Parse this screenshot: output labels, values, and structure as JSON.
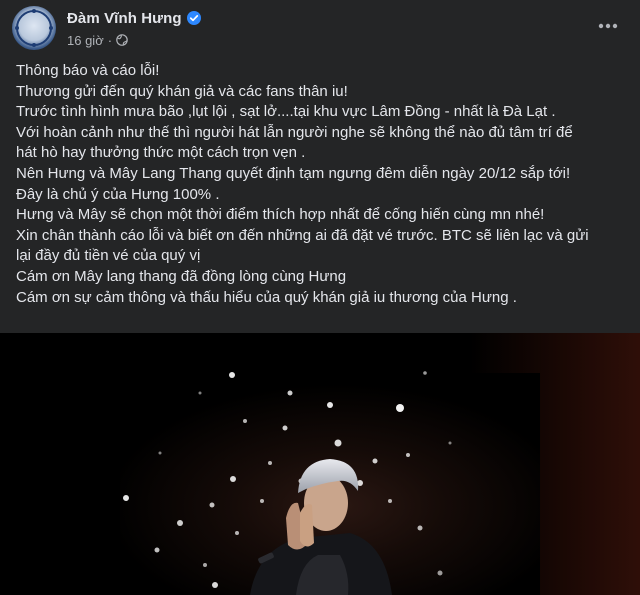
{
  "post": {
    "author_name": "Đàm Vĩnh Hưng",
    "timestamp": "16 giờ",
    "meta_separator": "·",
    "privacy_icon": "globe-icon",
    "verified_icon": "verified-badge-icon",
    "more_icon": "more-options-icon",
    "colors": {
      "background": "#242526",
      "text": "#e4e6eb",
      "secondary_text": "#b0b3b8",
      "verified": "#2d88ff"
    },
    "lines": [
      "Thông báo và cáo lỗi!",
      "Thương gửi đến quý khán giả và các fans thân iu!",
      "Trước tình hình mưa bão ,lụt lội , sạt lở....tại khu vực Lâm Đồng - nhất là Đà Lạt .",
      "Với hoàn cảnh như thế thì người hát lẫn người nghe sẽ không thể nào đủ tâm trí để",
      "hát hò hay thưởng thức một cách trọn vẹn .",
      "Nên Hưng và Mây Lang Thang quyết định tạm ngưng đêm diễn ngày 20/12 sắp tới!",
      "Đây là chủ ý của Hưng 100% .",
      "Hưng và Mây sẽ chọn một thời điểm thích hợp nhất để cống hiến cùng mn nhé!",
      "Xin chân thành cáo lỗi và biết ơn đến những ai đã đặt vé trước. BTC sẽ liên lạc và gửi",
      "lại đầy đủ tiền vé của quý vị",
      "Cám ơn Mây lang thang đã đồng lòng cùng Hưng",
      "Cám ơn sự cảm thông và thấu hiểu của quý khán giả iu thương của Hưng ."
    ],
    "photo": {
      "subject": "singer-on-stage-praying-photo"
    }
  }
}
